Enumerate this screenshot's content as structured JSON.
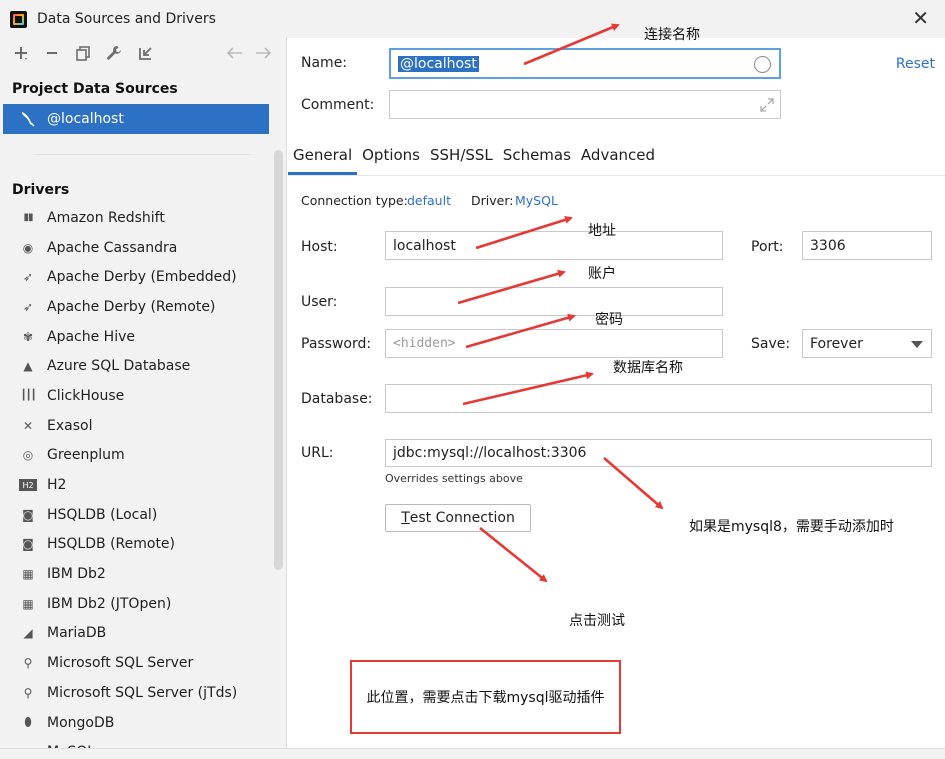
{
  "window": {
    "title": "Data Sources and Drivers"
  },
  "sidebar": {
    "project_label": "Project Data Sources",
    "selected": "@localhost",
    "drivers_label": "Drivers",
    "drivers": [
      {
        "label": "Amazon Redshift",
        "icon": "redshift-icon"
      },
      {
        "label": "Apache Cassandra",
        "icon": "cassandra-icon"
      },
      {
        "label": "Apache Derby (Embedded)",
        "icon": "derby-icon"
      },
      {
        "label": "Apache Derby (Remote)",
        "icon": "derby-icon"
      },
      {
        "label": "Apache Hive",
        "icon": "hive-icon"
      },
      {
        "label": "Azure SQL Database",
        "icon": "azure-icon"
      },
      {
        "label": "ClickHouse",
        "icon": "clickhouse-icon"
      },
      {
        "label": "Exasol",
        "icon": "exasol-icon"
      },
      {
        "label": "Greenplum",
        "icon": "greenplum-icon"
      },
      {
        "label": "H2",
        "icon": "h2-icon"
      },
      {
        "label": "HSQLDB (Local)",
        "icon": "hsqldb-icon"
      },
      {
        "label": "HSQLDB (Remote)",
        "icon": "hsqldb-icon"
      },
      {
        "label": "IBM Db2",
        "icon": "db2-icon"
      },
      {
        "label": "IBM Db2 (JTOpen)",
        "icon": "db2-icon"
      },
      {
        "label": "MariaDB",
        "icon": "mariadb-icon"
      },
      {
        "label": "Microsoft SQL Server",
        "icon": "mssql-icon"
      },
      {
        "label": "Microsoft SQL Server (jTds)",
        "icon": "mssql-icon"
      },
      {
        "label": "MongoDB",
        "icon": "mongodb-icon"
      },
      {
        "label": "MySQL",
        "icon": "mysql-icon"
      }
    ]
  },
  "form": {
    "name_label": "Name:",
    "name_value": "@localhost",
    "reset": "Reset",
    "comment_label": "Comment:",
    "comment_value": "",
    "tabs": [
      "General",
      "Options",
      "SSH/SSL",
      "Schemas",
      "Advanced"
    ],
    "connection_type_label": "Connection type:",
    "connection_type": "default",
    "driver_label": "Driver:",
    "driver": "MySQL",
    "host_label": "Host:",
    "host_value": "localhost",
    "port_label": "Port:",
    "port_value": "3306",
    "user_label": "User:",
    "user_value": "",
    "password_label": "Password:",
    "password_placeholder": "<hidden>",
    "save_label": "Save:",
    "save_value": "Forever",
    "database_label": "Database:",
    "database_value": "",
    "url_label": "URL:",
    "url_value": "jdbc:mysql://localhost:3306",
    "url_hint": "Overrides settings above",
    "test_button_prefix": "T",
    "test_button_rest": "est Connection"
  },
  "annotations": {
    "name": "连接名称",
    "host": "地址",
    "user": "账户",
    "password": "密码",
    "database": "数据库名称",
    "url": "如果是mysql8，需要手动添加时",
    "test": "点击测试",
    "driver_box": "此位置，需要点击下载mysql驱动插件"
  },
  "colors": {
    "accent": "#2d71c5",
    "arrow": "#e53935"
  }
}
